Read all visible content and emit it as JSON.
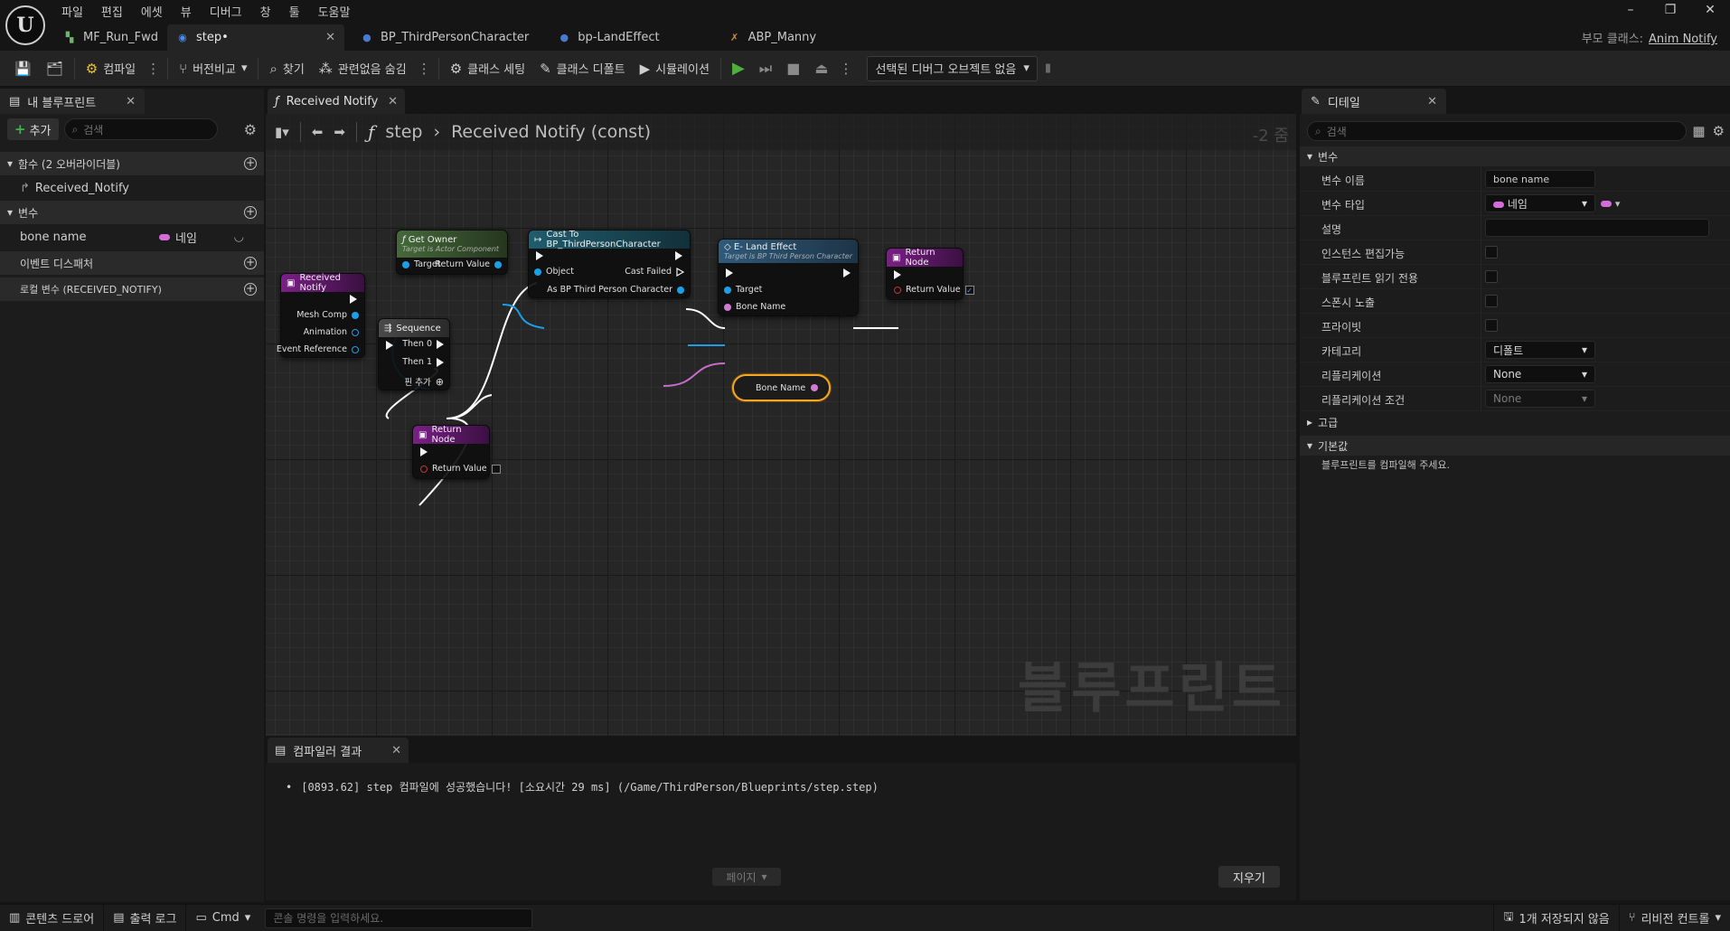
{
  "menu": [
    "파일",
    "편집",
    "에셋",
    "뷰",
    "디버그",
    "창",
    "툴",
    "도움말"
  ],
  "window_controls": {
    "minimize": "–",
    "restore": "❐",
    "close": "✕"
  },
  "tabs": [
    {
      "label": "MF_Run_Fwd",
      "icon": "anim-icon"
    },
    {
      "label": "step•",
      "icon": "blueprint-icon"
    },
    {
      "label": "BP_ThirdPersonCharacter",
      "icon": "character-icon"
    },
    {
      "label": "bp-LandEffect",
      "icon": "actor-icon"
    },
    {
      "label": "ABP_Manny",
      "icon": "animbp-icon"
    }
  ],
  "parent_class": {
    "label": "부모 클래스:",
    "value": "Anim Notify"
  },
  "toolbar": {
    "compile": "컴파일",
    "diff": "버전비교",
    "find": "찾기",
    "hide_unrelated": "관련없음 숨김",
    "class_settings": "클래스 세팅",
    "class_defaults": "클래스 디폴트",
    "simulation": "시뮬레이션",
    "debug_object": "선택된 디버그 오브젝트 없음"
  },
  "my_blueprint": {
    "tab": "내 블루프린트",
    "add": "추가",
    "search_placeholder": "검색",
    "sections": {
      "functions": "함수 (2 오버라이더블)",
      "function_item": "Received_Notify",
      "variables": "변수",
      "variable_name": "bone name",
      "variable_type": "네임",
      "event_dispatchers": "이벤트 디스패처",
      "local_vars": "로컬 변수 (RECEIVED_NOTIFY)"
    }
  },
  "graph": {
    "tab": "Received Notify",
    "breadcrumb_root": "step",
    "breadcrumb_leaf": "Received Notify (const)",
    "zoom": "-2 줌",
    "watermark": "블루프린트",
    "nodes": {
      "received_notify": {
        "title": "Received Notify",
        "pins": [
          "Mesh Comp",
          "Animation",
          "Event Reference"
        ]
      },
      "get_owner": {
        "title": "Get Owner",
        "subtitle": "Target is Actor Component",
        "pins": [
          "Target",
          "Return Value"
        ]
      },
      "cast": {
        "title": "Cast To BP_ThirdPersonCharacter",
        "pins": [
          "Object",
          "Cast Failed",
          "As BP Third Person Character"
        ]
      },
      "land_effect": {
        "title": "E- Land Effect",
        "subtitle": "Target is BP Third Person Character",
        "pins": [
          "Target",
          "Bone Name"
        ]
      },
      "return_top": {
        "title": "Return Node",
        "pins": [
          "Return Value"
        ]
      },
      "sequence": {
        "title": "Sequence",
        "pins": [
          "Then 0",
          "Then 1",
          "핀 추가"
        ]
      },
      "return_bottom": {
        "title": "Return Node",
        "pins": [
          "Return Value"
        ]
      },
      "bone_name_var": {
        "label": "Bone Name"
      }
    }
  },
  "compiler": {
    "tab": "컴파일러 결과",
    "message": "[0893.62] step 컴파일에 성공했습니다! [소요시간 29 ms] (/Game/ThirdPerson/Blueprints/step.step)",
    "page": "페이지",
    "clear": "지우기"
  },
  "details": {
    "tab": "디테일",
    "search_placeholder": "검색",
    "section_variable": "변수",
    "rows": {
      "name_label": "변수 이름",
      "name_value": "bone name",
      "type_label": "변수 타입",
      "type_value": "네임",
      "desc_label": "설명",
      "instance_editable": "인스턴스 편집가능",
      "bp_readonly": "블루프린트 읽기 전용",
      "expose_spawn": "스폰시 노출",
      "private": "프라이빗",
      "category_label": "카테고리",
      "category_value": "디폴트",
      "replication_label": "리플리케이션",
      "replication_value": "None",
      "rep_condition_label": "리플리케이션 조건",
      "rep_condition_value": "None"
    },
    "section_advanced": "고급",
    "section_default": "기본값",
    "default_note": "블루프린트를 컴파일해 주세요."
  },
  "statusbar": {
    "content_drawer": "콘텐츠 드로어",
    "output_log": "출력 로그",
    "cmd": "Cmd",
    "console_placeholder": "콘솔 명령을 입력하세요.",
    "unsaved": "1개 저장되지 않음",
    "revision": "리비전 컨트롤"
  },
  "colors": {
    "event_header": "#7a1f86",
    "pure_func_header": "#45693a",
    "cast_header": "#1f5d6e",
    "func_header": "#2f5a7a",
    "return_header": "#7a1f86",
    "seq_header": "#3a3a3a",
    "wire_exec": "#ffffff",
    "wire_object": "#1aa0e8",
    "wire_name": "#c66ec9"
  }
}
